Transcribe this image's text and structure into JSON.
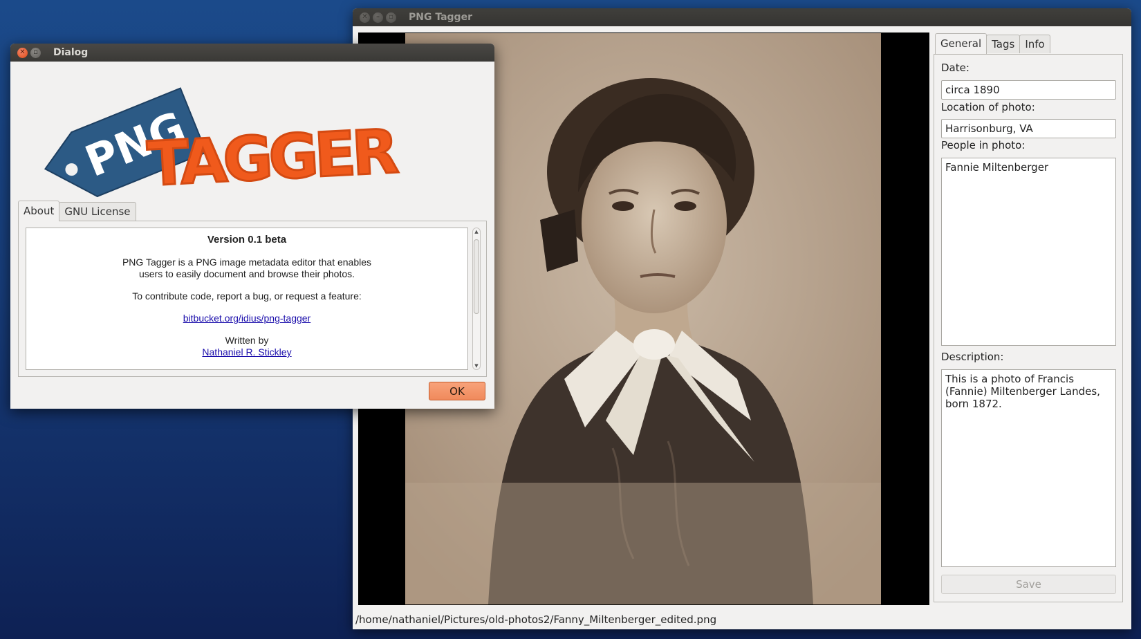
{
  "main_window": {
    "title": "PNG Tagger",
    "tabs": [
      "General",
      "Tags",
      "Info"
    ],
    "date_label": "Date:",
    "date_value": "circa 1890",
    "location_label": "Location of photo:",
    "location_value": "Harrisonburg, VA",
    "people_label": "People in photo:",
    "people_value": "Fannie Miltenberger",
    "description_label": "Description:",
    "description_value": "This is a photo of Francis (Fannie) Miltenberger Landes, born 1872.",
    "save_label": "Save",
    "status_path": "/home/nathaniel/Pictures/old-photos2/Fanny_Miltenberger_edited.png"
  },
  "dialog": {
    "title": "Dialog",
    "logo": {
      "tag_text": "PNG",
      "script_text": "TAGGER",
      "tag_color": "#2c5a85",
      "script_color": "#f05a1c"
    },
    "tabs": [
      "About",
      "GNU License"
    ],
    "version": "Version 0.1 beta",
    "description_line1": "PNG Tagger is a PNG image metadata editor that enables",
    "description_line2": "users to easily document and browse their photos.",
    "contribute": "To contribute code, report a bug, or request a feature:",
    "repo_link": "bitbucket.org/idius/png-tagger",
    "written_by": "Written by",
    "author_link": "Nathaniel R. Stickley",
    "ok_label": "OK"
  },
  "colors": {
    "desktop_top": "#1b4a8a",
    "desktop_bottom": "#0e2154",
    "accent_button": "#f08a5c",
    "close_button": "#dd4814"
  },
  "icons": {
    "close": "close-icon",
    "minimize": "minimize-icon",
    "maximize": "maximize-icon"
  }
}
